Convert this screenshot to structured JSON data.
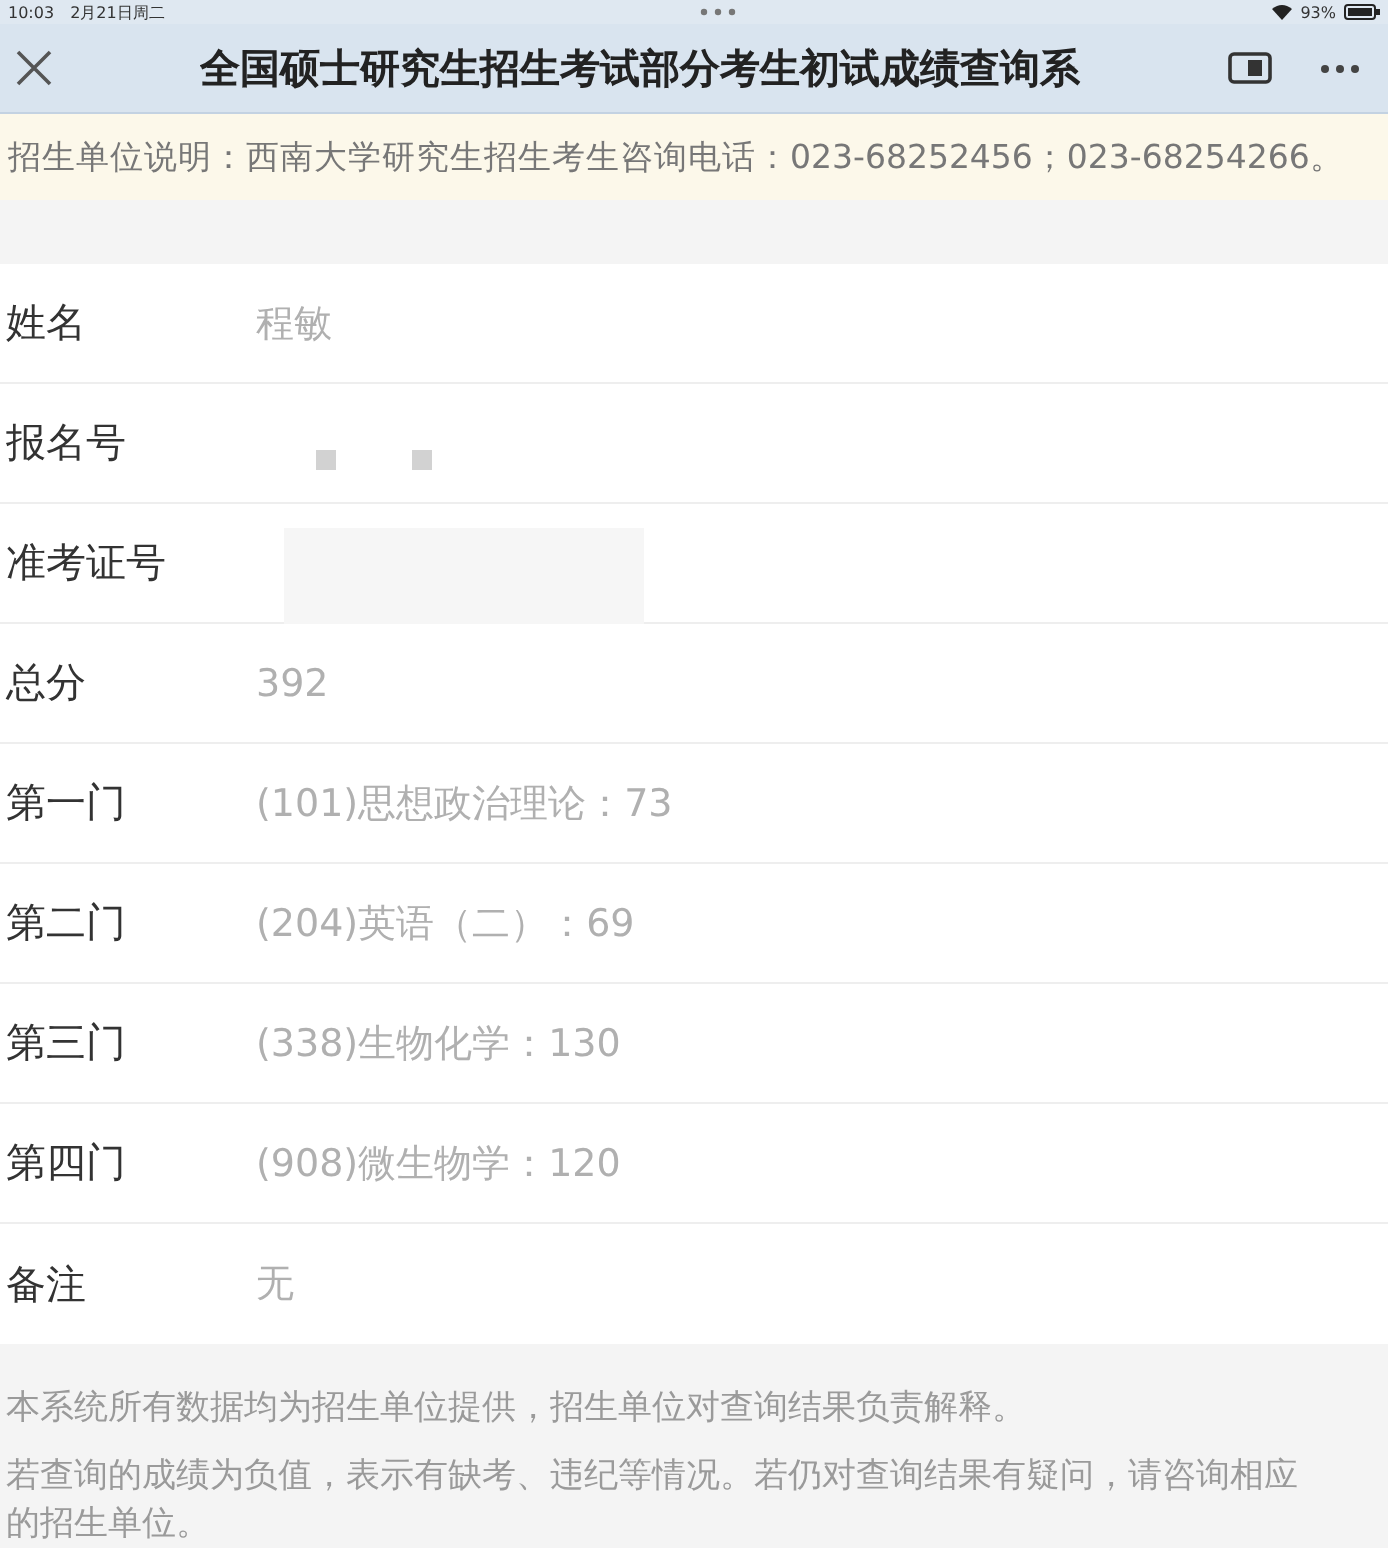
{
  "status_bar": {
    "time": "10:03",
    "date": "2月21日周二",
    "battery": "93%"
  },
  "nav_bar": {
    "title": "全国硕士研究生招生考试部分考生初试成绩查询系"
  },
  "notice": "招生单位说明：西南大学研究生招生考生咨询电话：023-68252456；023-68254266。",
  "fields": [
    {
      "kind": "text",
      "label": "姓名",
      "value": "程敏"
    },
    {
      "kind": "marks",
      "label": "报名号"
    },
    {
      "kind": "block",
      "label": "准考证号"
    },
    {
      "kind": "text",
      "label": "总分",
      "value": "392"
    },
    {
      "kind": "text",
      "label": "第一门",
      "value": "(101)思想政治理论：73"
    },
    {
      "kind": "text",
      "label": "第二门",
      "value": "(204)英语（二）：69"
    },
    {
      "kind": "text",
      "label": "第三门",
      "value": "(338)生物化学：130"
    },
    {
      "kind": "text",
      "label": "第四门",
      "value": "(908)微生物学：120"
    },
    {
      "kind": "text",
      "label": "备注",
      "value": "无"
    }
  ],
  "footer_notes": [
    "本系统所有数据均为招生单位提供，招生单位对查询结果负责解释。",
    "若查询的成绩为负值，表示有缺考、违纪等情况。若仍对查询结果有疑问，请咨询相应的招生单位。"
  ]
}
